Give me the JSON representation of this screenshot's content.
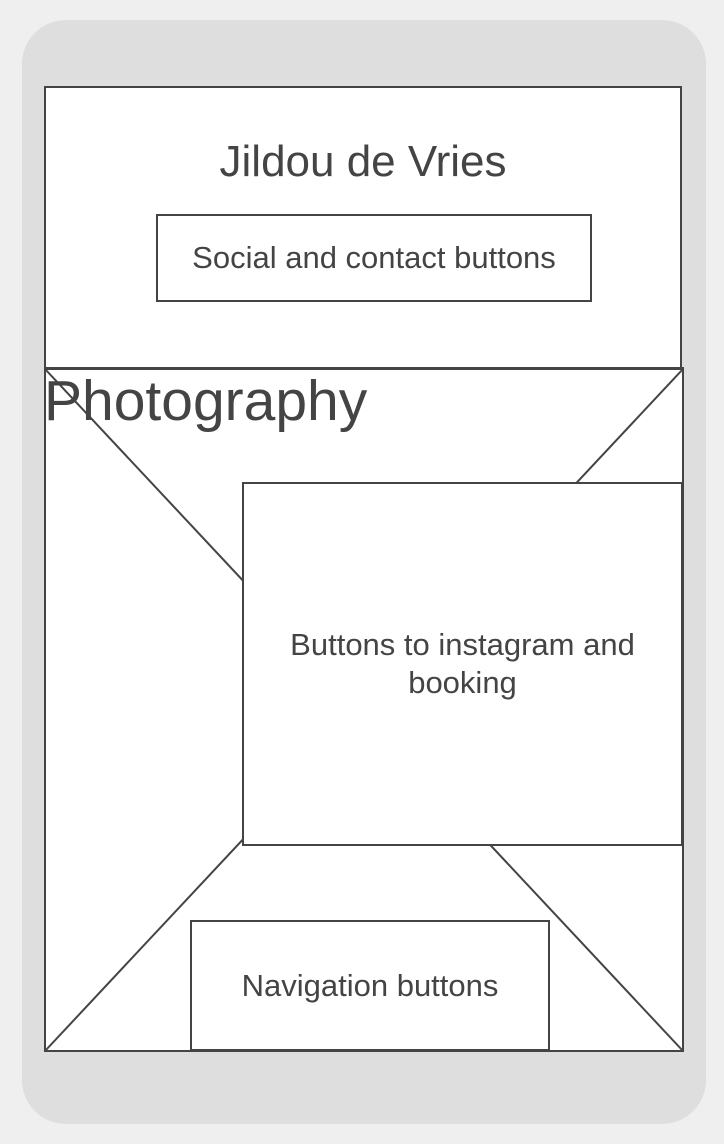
{
  "header": {
    "title": "Jildou de Vries",
    "social_label": "Social and contact buttons"
  },
  "hero": {
    "image_label": "Photography",
    "cta_label": "Buttons to instagram and booking"
  },
  "footer": {
    "nav_label": "Navigation buttons"
  },
  "colors": {
    "frame": "#dedede",
    "background": "#efefef",
    "stroke": "#444444",
    "fill": "#ffffff"
  }
}
